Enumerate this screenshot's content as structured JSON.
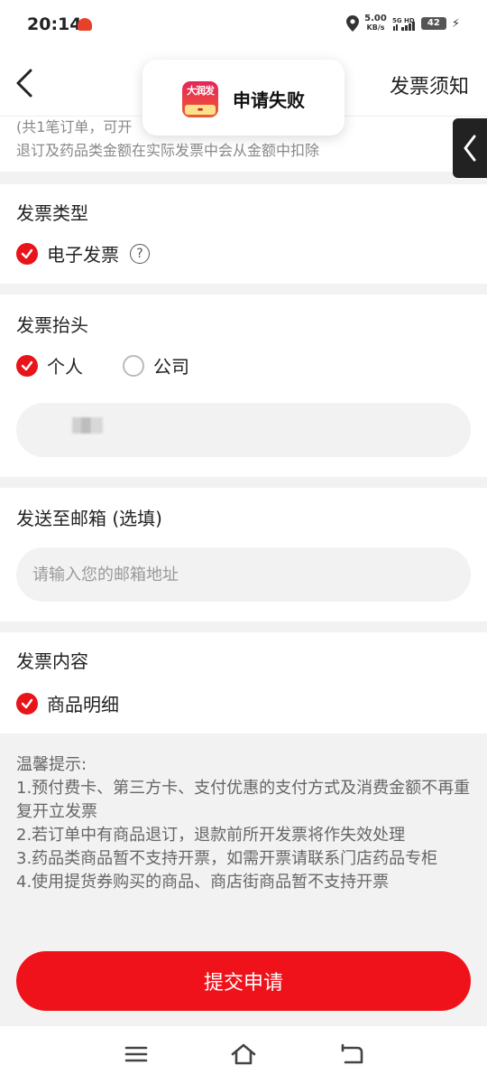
{
  "status": {
    "time": "20:14",
    "net_speed_value": "5.00",
    "net_speed_unit": "KB/s",
    "network": "5G HD",
    "battery": "42"
  },
  "header": {
    "notice_label": "发票须知"
  },
  "toast": {
    "app_logo_text": "大润发",
    "message": "申请失败"
  },
  "order_info": {
    "line1": "(共1笔订单，可开",
    "line2": "退订及药品类金额在实际发票中会从金额中扣除"
  },
  "invoice_type": {
    "title": "发票类型",
    "option": "电子发票",
    "help_symbol": "?"
  },
  "invoice_header": {
    "title": "发票抬头",
    "options": [
      "个人",
      "公司"
    ],
    "selected": "个人",
    "name_value": ""
  },
  "email": {
    "title": "发送至邮箱 (选填)",
    "placeholder": "请输入您的邮箱地址",
    "value": ""
  },
  "invoice_content": {
    "title": "发票内容",
    "option": "商品明细"
  },
  "tips": {
    "heading": "温馨提示:",
    "items": [
      "1.预付费卡、第三方卡、支付优惠的支付方式及消费金额不再重复开立发票",
      "2.若订单中有商品退订，退款前所开发票将作失效处理",
      "3.药品类商品暂不支持开票，如需开票请联系门店药品专柜",
      "4.使用提货券购买的商品、商店街商品暂不支持开票"
    ]
  },
  "submit_label": "提交申请",
  "colors": {
    "accent": "#f0121a",
    "background": "#f2f2f2"
  }
}
